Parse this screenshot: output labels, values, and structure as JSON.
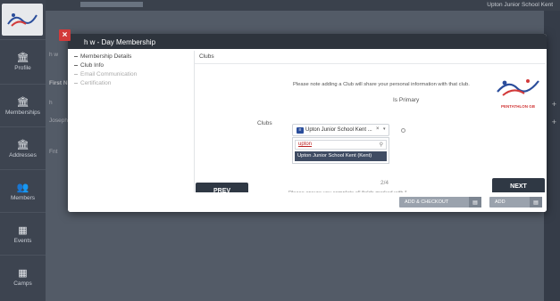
{
  "topbar": {
    "club_name": "Upton Junior School Kent"
  },
  "sidebar": {
    "items": [
      {
        "label": "Profile",
        "icon": "bank-icon"
      },
      {
        "label": "Memberships",
        "icon": "bank-icon"
      },
      {
        "label": "Addresses",
        "icon": "bank-icon"
      },
      {
        "label": "Members",
        "icon": "users-icon"
      },
      {
        "label": "Events",
        "icon": "calendar-icon"
      },
      {
        "label": "Camps",
        "icon": "calendar-icon"
      }
    ]
  },
  "background": {
    "rows": [
      "h w",
      "First N",
      "h",
      "Joseph",
      "Fnt"
    ]
  },
  "modal": {
    "title": "h w - Day Membership",
    "close": "×",
    "steps": [
      {
        "label": "Membership Details",
        "state": "done"
      },
      {
        "label": "Club Info",
        "state": "current"
      },
      {
        "label": "Email Communication",
        "state": "pending"
      },
      {
        "label": "Certification",
        "state": "pending"
      }
    ],
    "section_title": "Clubs",
    "note": "Please note adding a Club will share your personal information with that club.",
    "is_primary_label": "Is Primary",
    "clubs_label": "Clubs",
    "selected_club": "Upton Junior School Kent ...",
    "clear": "×",
    "caret": "▾",
    "search_value": "upton",
    "search_icon": "search-icon",
    "option": "Upton Junior School Kent (Kent)",
    "prev_label": "PREV",
    "next_label": "NEXT",
    "pager": "2/4",
    "footnote": "Please ensure you complete all fields marked with *",
    "add_checkout_label": "ADD & CHECKOUT",
    "add_label": "ADD",
    "brand_text": "PENTATHLON GB"
  },
  "colors": {
    "header": "#2e343d",
    "close": "#d23a3a",
    "option_bg": "#3f4c63",
    "button": "#2f3844"
  }
}
